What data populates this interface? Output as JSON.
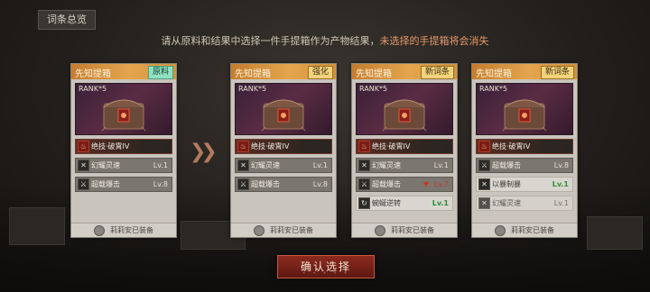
{
  "top_title": "词条总览",
  "instruction": {
    "normal": "请从原料和结果中选择一件手提箱作为产物结果，",
    "warning": "未选择的手提箱将会消失"
  },
  "cards": [
    {
      "header": "先知提箱",
      "tag": "原料",
      "rank": "RANK*5",
      "main_affix": "绝技·破霄IV",
      "affixes": [
        {
          "name": "幻耀灵速",
          "level": "Lv.1"
        },
        {
          "name": "超载爆击",
          "level": "Lv.8"
        }
      ],
      "footer": "莉莉安已装备"
    },
    {
      "header": "先知提箱",
      "tag": "强化",
      "rank": "RANK*5",
      "main_affix": "绝技·破霄IV",
      "affixes": [
        {
          "name": "幻耀灵速",
          "level": "Lv.1"
        },
        {
          "name": "超载爆击",
          "level": "Lv.8"
        }
      ],
      "footer": "莉莉安已装备"
    },
    {
      "header": "先知提箱",
      "tag": "新词条",
      "rank": "RANK*5",
      "main_affix": "绝技·破霄IV",
      "affixes": [
        {
          "name": "幻耀灵速",
          "level": "Lv.1"
        },
        {
          "name": "超载爆击",
          "level": "Lv.7"
        },
        {
          "name": "蜿蜒逆转",
          "level": "Lv.1"
        }
      ],
      "footer": "莉莉安已装备"
    },
    {
      "header": "先知提箱",
      "tag": "新词条",
      "rank": "RANK*5",
      "main_affix": "绝技·破霄IV",
      "affixes": [
        {
          "name": "超载爆击",
          "level": "Lv.8"
        },
        {
          "name": "以暴制暴",
          "level": "Lv.1"
        },
        {
          "name": "幻耀灵速",
          "level": "Lv.1"
        }
      ],
      "footer": "莉莉安已装备"
    }
  ],
  "confirm_button": "确认选择"
}
